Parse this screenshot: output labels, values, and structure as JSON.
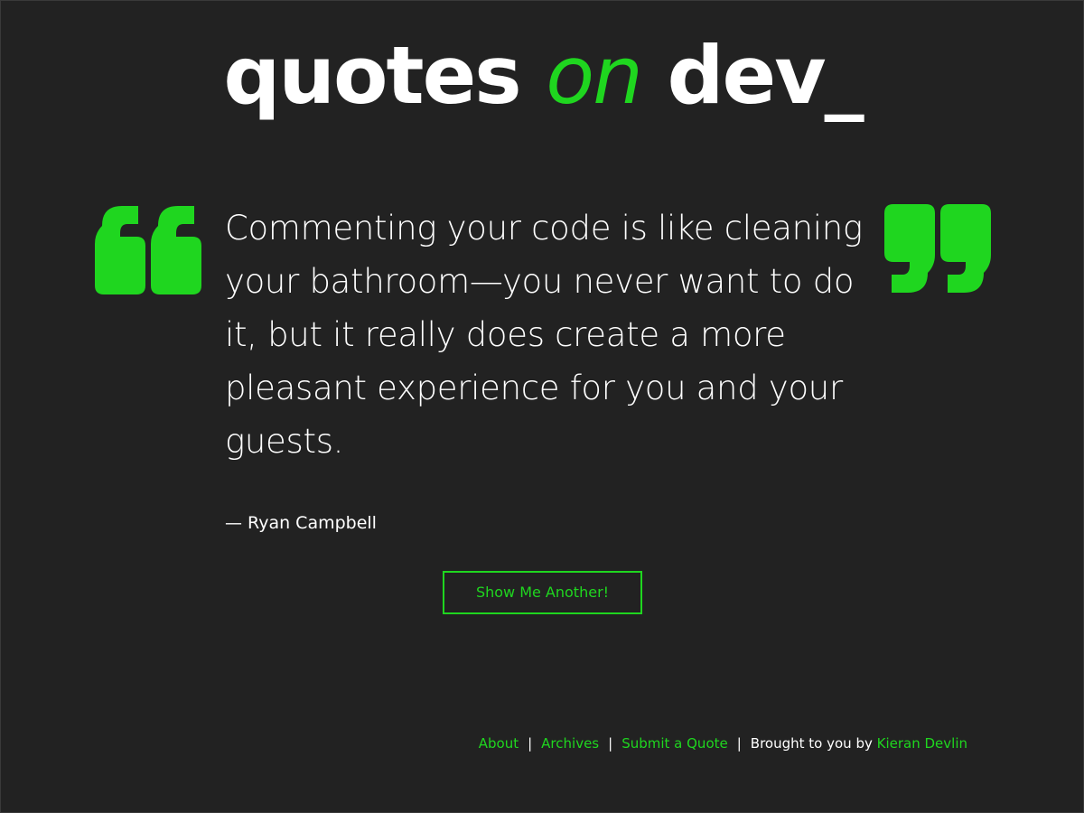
{
  "logo": {
    "word1": "quotes",
    "word2": "on",
    "word3": "dev_"
  },
  "quote": {
    "text": "Commenting your code is like cleaning your bathroom—you never want to do it, but it really does create a more pleasant experience for you and your guests.",
    "author": "— Ryan Campbell"
  },
  "button": {
    "label": "Show Me Another!"
  },
  "footer": {
    "links": [
      "About",
      "Archives",
      "Submit a Quote"
    ],
    "separator": "|",
    "credit_prefix": "Brought to you by",
    "credit_name": "Kieran Devlin"
  },
  "colors": {
    "accent": "#1fd61f",
    "background": "#222222",
    "text": "#ffffff"
  },
  "icons": {
    "open_quote": "open-quote-icon",
    "close_quote": "close-quote-icon"
  }
}
